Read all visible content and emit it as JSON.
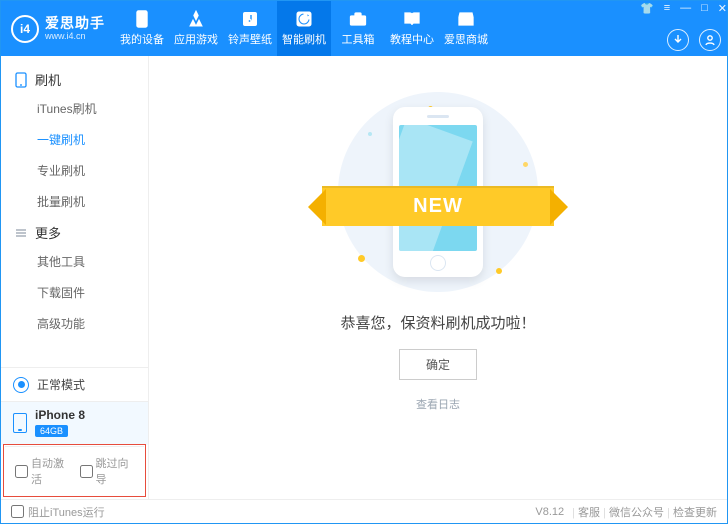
{
  "header": {
    "logo_badge": "i4",
    "logo_cn": "爱思助手",
    "logo_url": "www.i4.cn",
    "nav": [
      {
        "label": "我的设备",
        "icon": "phone"
      },
      {
        "label": "应用游戏",
        "icon": "apps"
      },
      {
        "label": "铃声壁纸",
        "icon": "music"
      },
      {
        "label": "智能刷机",
        "icon": "flash",
        "active": true
      },
      {
        "label": "工具箱",
        "icon": "toolbox"
      },
      {
        "label": "教程中心",
        "icon": "book"
      },
      {
        "label": "爱思商城",
        "icon": "store"
      }
    ]
  },
  "sidebar": {
    "group1": {
      "label": "刷机"
    },
    "items1": [
      {
        "label": "iTunes刷机"
      },
      {
        "label": "一键刷机",
        "active": true
      },
      {
        "label": "专业刷机"
      },
      {
        "label": "批量刷机"
      }
    ],
    "group2": {
      "label": "更多"
    },
    "items2": [
      {
        "label": "其他工具"
      },
      {
        "label": "下载固件"
      },
      {
        "label": "高级功能"
      }
    ],
    "mode": "正常模式",
    "device_name": "iPhone 8",
    "device_badge": "64GB",
    "opt_auto": "自动激活",
    "opt_skip": "跳过向导"
  },
  "main": {
    "ribbon": "NEW",
    "message": "恭喜您，保资料刷机成功啦！",
    "ok": "确定",
    "log": "查看日志"
  },
  "footer": {
    "block_itunes": "阻止iTunes运行",
    "version": "V8.12",
    "links": [
      "客服",
      "微信公众号",
      "检查更新"
    ]
  }
}
